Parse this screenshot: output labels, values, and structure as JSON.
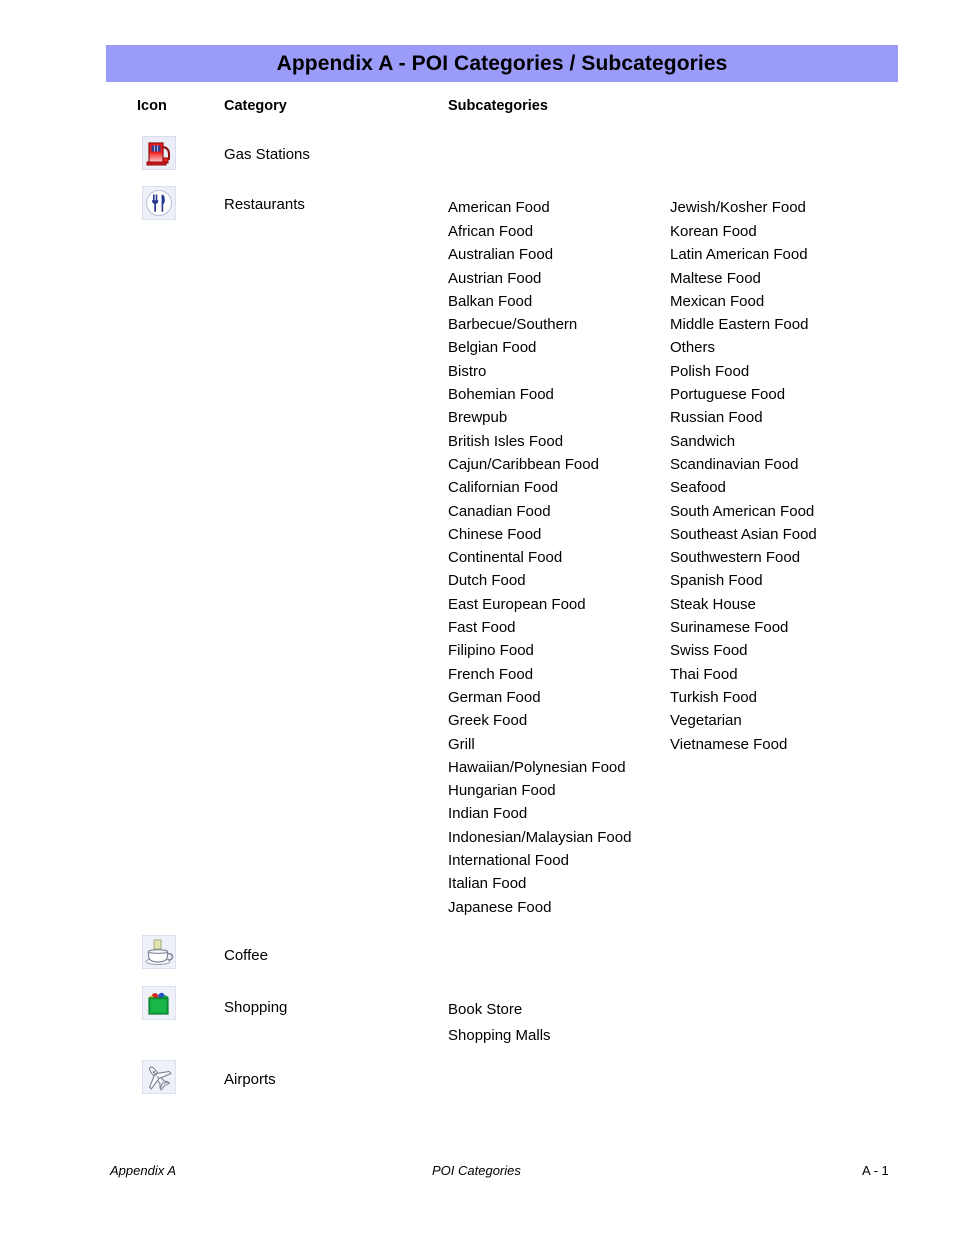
{
  "banner": {
    "title": "Appendix A - POI Categories / Subcategories",
    "bg_color": "#9b9bfa",
    "text_color": "#000000"
  },
  "table_headers": {
    "icon": "Icon",
    "category": "Category",
    "subcategories": "Subcategories"
  },
  "rows": [
    {
      "icon_name": "gas-pump-icon",
      "category": "Gas Stations",
      "subcategories_left": [],
      "subcategories_right": []
    },
    {
      "icon_name": "restaurant-fork-knife-icon",
      "category": "Restaurants",
      "subcategories_left": [
        "American Food",
        "African Food",
        "Australian Food",
        "Austrian Food",
        "Balkan Food",
        "Barbecue/Southern",
        "Belgian Food",
        "Bistro",
        "Bohemian Food",
        "Brewpub",
        "British Isles Food",
        "Cajun/Caribbean Food",
        "Californian Food",
        "Canadian Food",
        "Chinese Food",
        "Continental Food",
        "Dutch Food",
        "East European Food",
        "Fast Food",
        "Filipino Food",
        "French Food",
        "German Food",
        "Greek Food",
        "Grill",
        "Hawaiian/Polynesian Food",
        "Hungarian Food",
        "Indian Food",
        "Indonesian/Malaysian Food",
        "International Food",
        "Italian Food",
        "Japanese Food"
      ],
      "subcategories_right": [
        "Jewish/Kosher Food",
        "Korean Food",
        "Latin American Food",
        "Maltese Food",
        "Mexican Food",
        "Middle Eastern Food",
        "Others",
        "Polish Food",
        "Portuguese Food",
        "Russian Food",
        "Sandwich",
        "Scandinavian Food",
        "Seafood",
        "South American Food",
        "Southeast Asian Food",
        "Southwestern Food",
        "Spanish Food",
        "Steak House",
        "Surinamese Food",
        "Swiss Food",
        "Thai Food",
        "Turkish Food",
        "Vegetarian",
        "Vietnamese Food"
      ]
    },
    {
      "icon_name": "coffee-cup-icon",
      "category": "Coffee",
      "subcategories_left": [],
      "subcategories_right": []
    },
    {
      "icon_name": "shopping-bag-icon",
      "category": "Shopping",
      "subcategories_left": [
        "Book Store",
        "Shopping Malls"
      ],
      "subcategories_right": []
    },
    {
      "icon_name": "airplane-icon",
      "category": "Airports",
      "subcategories_left": [],
      "subcategories_right": []
    }
  ],
  "footer": {
    "left": "Appendix A",
    "center": "POI Categories",
    "right": "A - 1"
  }
}
